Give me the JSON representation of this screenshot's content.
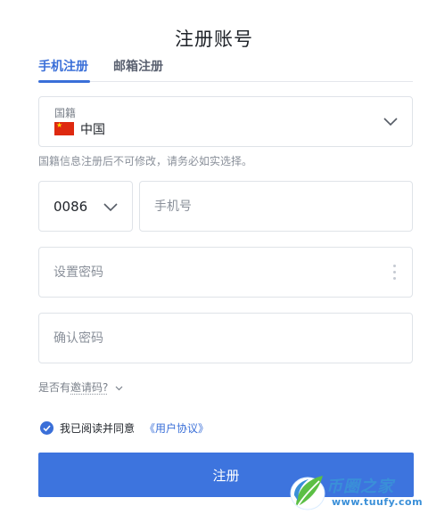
{
  "page": {
    "title": "注册账号"
  },
  "tabs": [
    {
      "label": "手机注册",
      "active": true
    },
    {
      "label": "邮箱注册",
      "active": false
    }
  ],
  "country": {
    "label": "国籍",
    "value": "中国",
    "flag_icon": "china-flag-icon"
  },
  "hint": "国籍信息注册后不可修改，请务必如实选择。",
  "phone": {
    "country_code": "0086",
    "placeholder": "手机号",
    "value": ""
  },
  "password": {
    "placeholder": "设置密码",
    "value": ""
  },
  "confirm_password": {
    "placeholder": "确认密码",
    "value": ""
  },
  "invite": {
    "prefix": "是否有",
    "link": "邀请码?"
  },
  "agreement": {
    "checked": true,
    "text": "我已阅读并同意",
    "link": "《用户协议》"
  },
  "submit_label": "注册",
  "watermark": {
    "name": "币圈之家",
    "url": "www.tuufy.com"
  },
  "colors": {
    "accent": "#3d74de",
    "link": "#3a6fd8",
    "border": "#dfe3e8",
    "muted": "#8a909a",
    "flag_red": "#de2910"
  }
}
